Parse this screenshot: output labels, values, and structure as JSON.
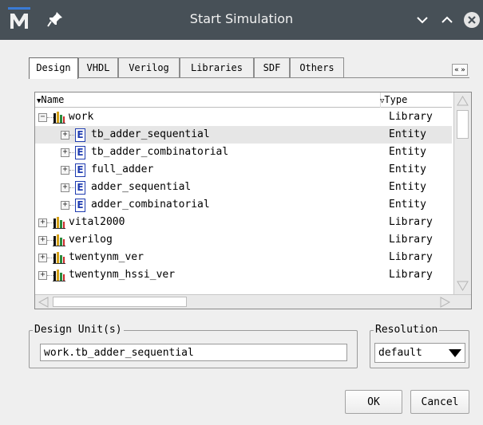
{
  "window": {
    "title": "Start Simulation",
    "app_icon": "modelsim-logo-icon",
    "controls": [
      "chevron-down-icon",
      "chevron-up-icon",
      "close-icon"
    ]
  },
  "tabs": [
    {
      "label": "Design",
      "active": true
    },
    {
      "label": "VHDL",
      "active": false
    },
    {
      "label": "Verilog",
      "active": false
    },
    {
      "label": "Libraries",
      "active": false
    },
    {
      "label": "SDF",
      "active": false
    },
    {
      "label": "Others",
      "active": false
    }
  ],
  "tab_scroll": {
    "left": "«",
    "right": "»"
  },
  "library_list": {
    "columns": {
      "name": "Name",
      "type": "Type"
    },
    "rows": [
      {
        "name": "work",
        "type": "Library",
        "kind": "library",
        "expanded": true,
        "level": 0,
        "selected": false
      },
      {
        "name": "tb_adder_sequential",
        "type": "Entity",
        "kind": "entity",
        "level": 1,
        "selected": true
      },
      {
        "name": "tb_adder_combinatorial",
        "type": "Entity",
        "kind": "entity",
        "level": 1,
        "selected": false
      },
      {
        "name": "full_adder",
        "type": "Entity",
        "kind": "entity",
        "level": 1,
        "selected": false
      },
      {
        "name": "adder_sequential",
        "type": "Entity",
        "kind": "entity",
        "level": 1,
        "selected": false
      },
      {
        "name": "adder_combinatorial",
        "type": "Entity",
        "kind": "entity",
        "level": 1,
        "selected": false
      },
      {
        "name": "vital2000",
        "type": "Library",
        "kind": "library",
        "expanded": false,
        "level": 0,
        "selected": false
      },
      {
        "name": "verilog",
        "type": "Library",
        "kind": "library",
        "expanded": false,
        "level": 0,
        "selected": false
      },
      {
        "name": "twentynm_ver",
        "type": "Library",
        "kind": "library",
        "expanded": false,
        "level": 0,
        "selected": false
      },
      {
        "name": "twentynm_hssi_ver",
        "type": "Library",
        "kind": "library",
        "expanded": false,
        "level": 0,
        "selected": false
      }
    ]
  },
  "design_units": {
    "label": "Design Unit(s)",
    "value": "work.tb_adder_sequential"
  },
  "resolution": {
    "label": "Resolution",
    "value": "default"
  },
  "buttons": {
    "ok": "OK",
    "cancel": "Cancel"
  },
  "colors": {
    "titlebar": "#475057",
    "selected_row": "#e6e6e6",
    "entity_icon": "#1f3cb0"
  }
}
